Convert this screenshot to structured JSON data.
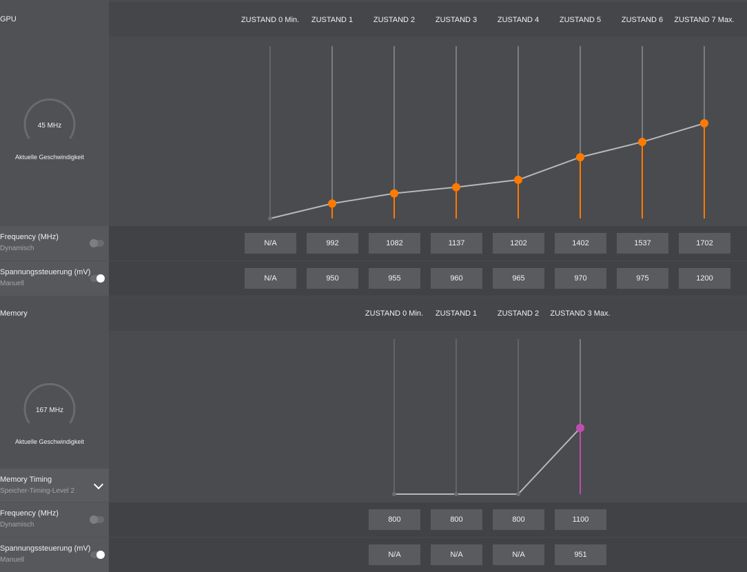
{
  "gpu": {
    "header": "GPU",
    "states": [
      "ZUSTAND 0 Min.",
      "ZUSTAND 1",
      "ZUSTAND 2",
      "ZUSTAND 3",
      "ZUSTAND 4",
      "ZUSTAND 5",
      "ZUSTAND 6",
      "ZUSTAND 7 Max."
    ],
    "gauge": {
      "value": "45 MHz",
      "caption": "Aktuelle Geschwindigkeit"
    },
    "frequency": {
      "label": "Frequency (MHz)",
      "mode": "Dynamisch",
      "toggle_on": false,
      "values": [
        "N/A",
        "992",
        "1082",
        "1137",
        "1202",
        "1402",
        "1537",
        "1702"
      ]
    },
    "voltage": {
      "label": "Spannungssteuerung (mV)",
      "mode": "Manuell",
      "toggle_on": true,
      "values": [
        "N/A",
        "950",
        "955",
        "960",
        "965",
        "970",
        "975",
        "1200"
      ]
    }
  },
  "memory": {
    "header": "Memory",
    "states": [
      "ZUSTAND 0 Min.",
      "ZUSTAND 1",
      "ZUSTAND 2",
      "ZUSTAND 3 Max."
    ],
    "gauge": {
      "value": "167 MHz",
      "caption": "Aktuelle Geschwindigkeit"
    },
    "timing": {
      "label": "Memory Timing",
      "value": "Speicher-Timing-Level 2"
    },
    "frequency": {
      "label": "Frequency (MHz)",
      "mode": "Dynamisch",
      "toggle_on": false,
      "values": [
        "800",
        "800",
        "800",
        "1100"
      ]
    },
    "voltage": {
      "label": "Spannungssteuerung (mV)",
      "mode": "Manuell",
      "toggle_on": true,
      "values": [
        "N/A",
        "N/A",
        "N/A",
        "951"
      ]
    }
  },
  "colors": {
    "accent": "#ff7a00",
    "memory_accent": "#c04db0",
    "line": "#b8b8b8"
  }
}
